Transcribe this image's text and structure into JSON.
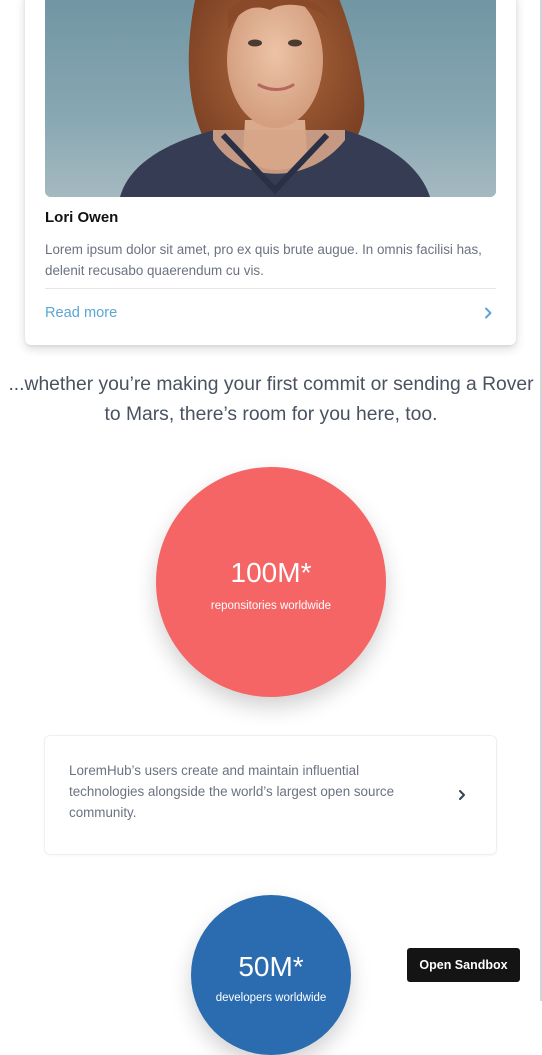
{
  "profile_card": {
    "name": "Lori Owen",
    "description": "Lorem ipsum dolor sit amet, pro ex quis brute augue. In omnis facilisi has, delenit recusabo quaerendum cu vis.",
    "link_label": "Read more",
    "link_icon": "chevron-right-icon",
    "photo_alt": "portrait-photo"
  },
  "tagline": "...whether you’re making your first commit or sending a Rover to Mars, there’s room for you here, too.",
  "stats": [
    {
      "value": "100M*",
      "label": "reponsitories worldwide",
      "color": "#f56565"
    },
    {
      "value": "50M*",
      "label": "developers worldwide",
      "color": "#2b6cb0"
    }
  ],
  "info_card": {
    "text": "LoremHub’s users create and maintain influential technologies alongside the world’s largest open source community.",
    "icon": "chevron-right-icon"
  },
  "sandbox_button": {
    "label": "Open Sandbox"
  },
  "colors": {
    "link": "#5ba6d6",
    "text_muted": "#6b7280",
    "heading": "#111111",
    "button_bg": "#141414"
  }
}
